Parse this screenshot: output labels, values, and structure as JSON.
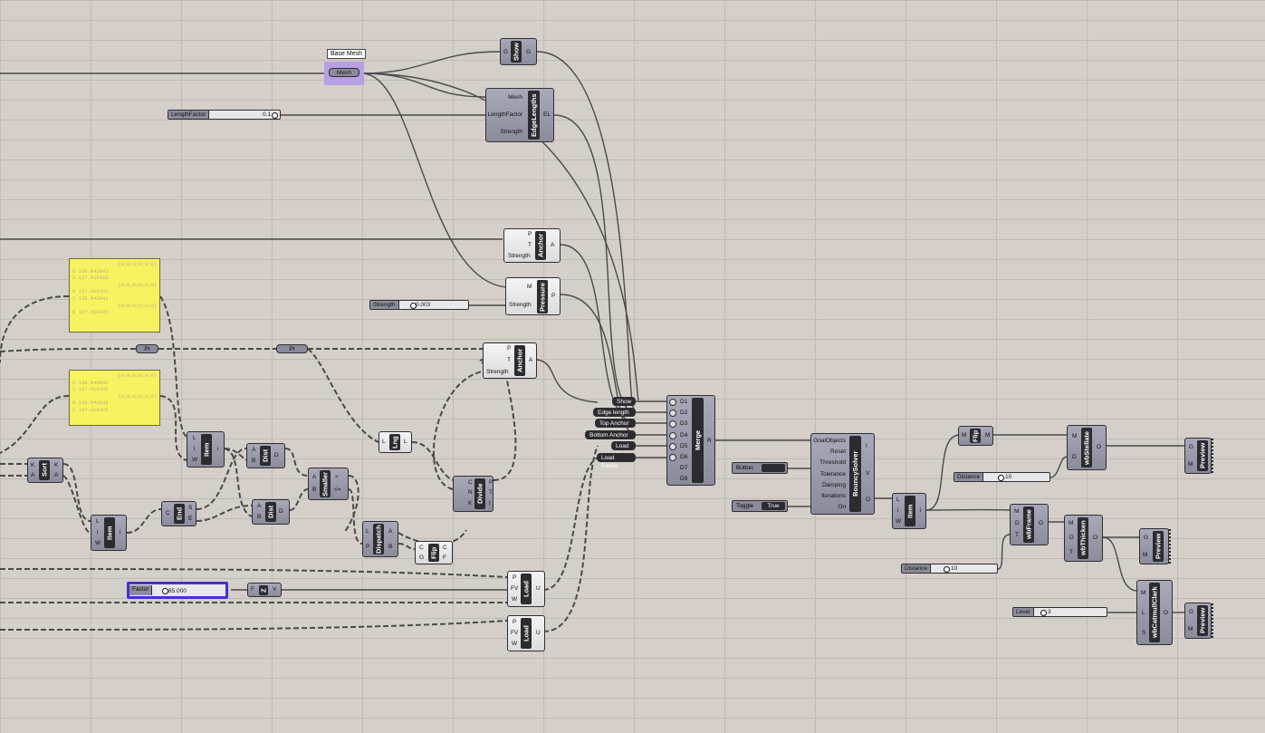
{
  "canvas": {
    "grid_color": "#bfbab3",
    "background": "#d4cfc8",
    "wire_color": "#444444",
    "component_fill": "#8b8b9c",
    "panel_fill": "#f7f25f",
    "highlight_color": "#b79fe3",
    "selection_color": "#4433cc"
  },
  "tooltip": {
    "text": "Base Mesh"
  },
  "mesh_param": {
    "label": "Mesh"
  },
  "show_comp": {
    "name": "Show",
    "in": "G",
    "out": "G"
  },
  "edge_lengths": {
    "name": "EdgeLengths",
    "inputs": [
      "Mesh",
      "LengthFactor",
      "Strength"
    ],
    "out": "EL"
  },
  "length_factor": {
    "label": "LengthFactor",
    "value": "0.1"
  },
  "anchor1": {
    "name": "Anchor",
    "inputs": [
      "P",
      "T",
      "Strength"
    ],
    "out": "A"
  },
  "pressure": {
    "name": "Pressure",
    "inputs": [
      "M",
      "Strength"
    ],
    "out": "P"
  },
  "strength_slider": {
    "label": "Strength",
    "value": "0.003"
  },
  "anchor2": {
    "name": "Anchor",
    "inputs": [
      "P",
      "T",
      "Strength"
    ],
    "out": "A"
  },
  "panel1": {
    "lines": [
      "{0;0;0;0;0;0}",
      "0 136.943843",
      "1 137.015425",
      "{0;0;0;0;1;0}",
      "0 137.015425",
      "1 136.943843",
      "{0;0;0;0;2;0}",
      "0 137.015425"
    ]
  },
  "panel2": {
    "lines": [
      "{0;0;0;0;0;0}",
      "0 136.943843",
      "1 137.015425",
      "{0;0;0;0;1;0}",
      "0 136.943843",
      "1 137.015425"
    ]
  },
  "pt1": {
    "label": "Pt"
  },
  "pt2": {
    "label": "Pt"
  },
  "sort_comp": {
    "name": "Sort",
    "inputs": [
      "K",
      "A"
    ],
    "outputs": [
      "K",
      "A"
    ]
  },
  "item1": {
    "name": "Item",
    "inputs": [
      "L",
      "i",
      "W"
    ],
    "out": "i"
  },
  "item2": {
    "name": "Item",
    "inputs": [
      "L",
      "i",
      "W"
    ],
    "out": "i"
  },
  "dist1": {
    "name": "Dist",
    "inputs": [
      "A",
      "B"
    ],
    "out": "D"
  },
  "dist2": {
    "name": "Dist",
    "inputs": [
      "A",
      "B"
    ],
    "out": "D"
  },
  "end_comp": {
    "name": "End",
    "inputs": [
      "C"
    ],
    "outputs": [
      "S",
      "E"
    ]
  },
  "smaller_comp": {
    "name": "Smaller",
    "inputs": [
      "A",
      "B"
    ],
    "outputs": [
      "<",
      "<="
    ]
  },
  "lng_comp": {
    "name": "Lng",
    "inputs": [
      "L"
    ],
    "out": "L"
  },
  "dispatch_comp": {
    "name": "Dispatch",
    "inputs": [
      "L",
      "P"
    ],
    "outputs": [
      "A",
      "B"
    ]
  },
  "flip_comp": {
    "name": "Flip",
    "inputs": [
      "C",
      "G"
    ],
    "outputs": [
      "C",
      "F"
    ]
  },
  "divide_comp": {
    "name": "Divide",
    "inputs": [
      "C",
      "N",
      "K"
    ],
    "outputs": [
      "P",
      "T",
      "t"
    ]
  },
  "factor_slider": {
    "label": "Factor",
    "value": "85.000"
  },
  "z_comp": {
    "name": "Z",
    "in": "F",
    "out": "V"
  },
  "load1": {
    "name": "Load",
    "inputs": [
      "P",
      "FV",
      "W"
    ],
    "out": "U"
  },
  "load2": {
    "name": "Load",
    "inputs": [
      "P",
      "FV",
      "W"
    ],
    "out": "U"
  },
  "relay_tags": [
    "Show",
    "Edge length",
    "Top Anchor",
    "Bottom Anchor",
    "Load z",
    "Load Radial"
  ],
  "merge": {
    "name": "Merge",
    "inputs": [
      "D1",
      "D2",
      "D3",
      "D4",
      "D5",
      "D6",
      "D7",
      "D8"
    ],
    "out": "R"
  },
  "button": {
    "label": "Button"
  },
  "toggle": {
    "label": "Toggle",
    "value": "True"
  },
  "solver": {
    "name": "BouncySolver",
    "inputs": [
      "GoalObjects",
      "Reset",
      "Threshold",
      "Tolerance",
      "Damping",
      "Iterations",
      "On"
    ],
    "outputs": [
      "I",
      "V",
      "O"
    ]
  },
  "item3": {
    "name": "Item",
    "inputs": [
      "L",
      "i",
      "W"
    ],
    "out": "i"
  },
  "flip2": {
    "name": "Flip",
    "in": "M",
    "out": "M"
  },
  "stellate": {
    "name": "wbStellate",
    "inputs": [
      "M",
      "D"
    ],
    "out": "O"
  },
  "distance1": {
    "label": "Distance",
    "value": "10"
  },
  "preview1": {
    "name": "Preview",
    "inputs": [
      "G",
      "M"
    ]
  },
  "frame": {
    "name": "wbFrame",
    "inputs": [
      "M",
      "D",
      "T"
    ],
    "out": "O"
  },
  "distance2": {
    "label": "Distance",
    "value": "10"
  },
  "thicken": {
    "name": "wbThicken",
    "inputs": [
      "M",
      "D",
      "T"
    ],
    "out": "O"
  },
  "preview2": {
    "name": "Preview",
    "inputs": [
      "G",
      "M"
    ]
  },
  "catmull": {
    "name": "wbCatmullClark",
    "inputs": [
      "M",
      "L",
      "S"
    ],
    "out": "O"
  },
  "level_slider": {
    "label": "Level",
    "value": "3"
  },
  "preview3": {
    "name": "Preview",
    "inputs": [
      "G",
      "M"
    ]
  }
}
